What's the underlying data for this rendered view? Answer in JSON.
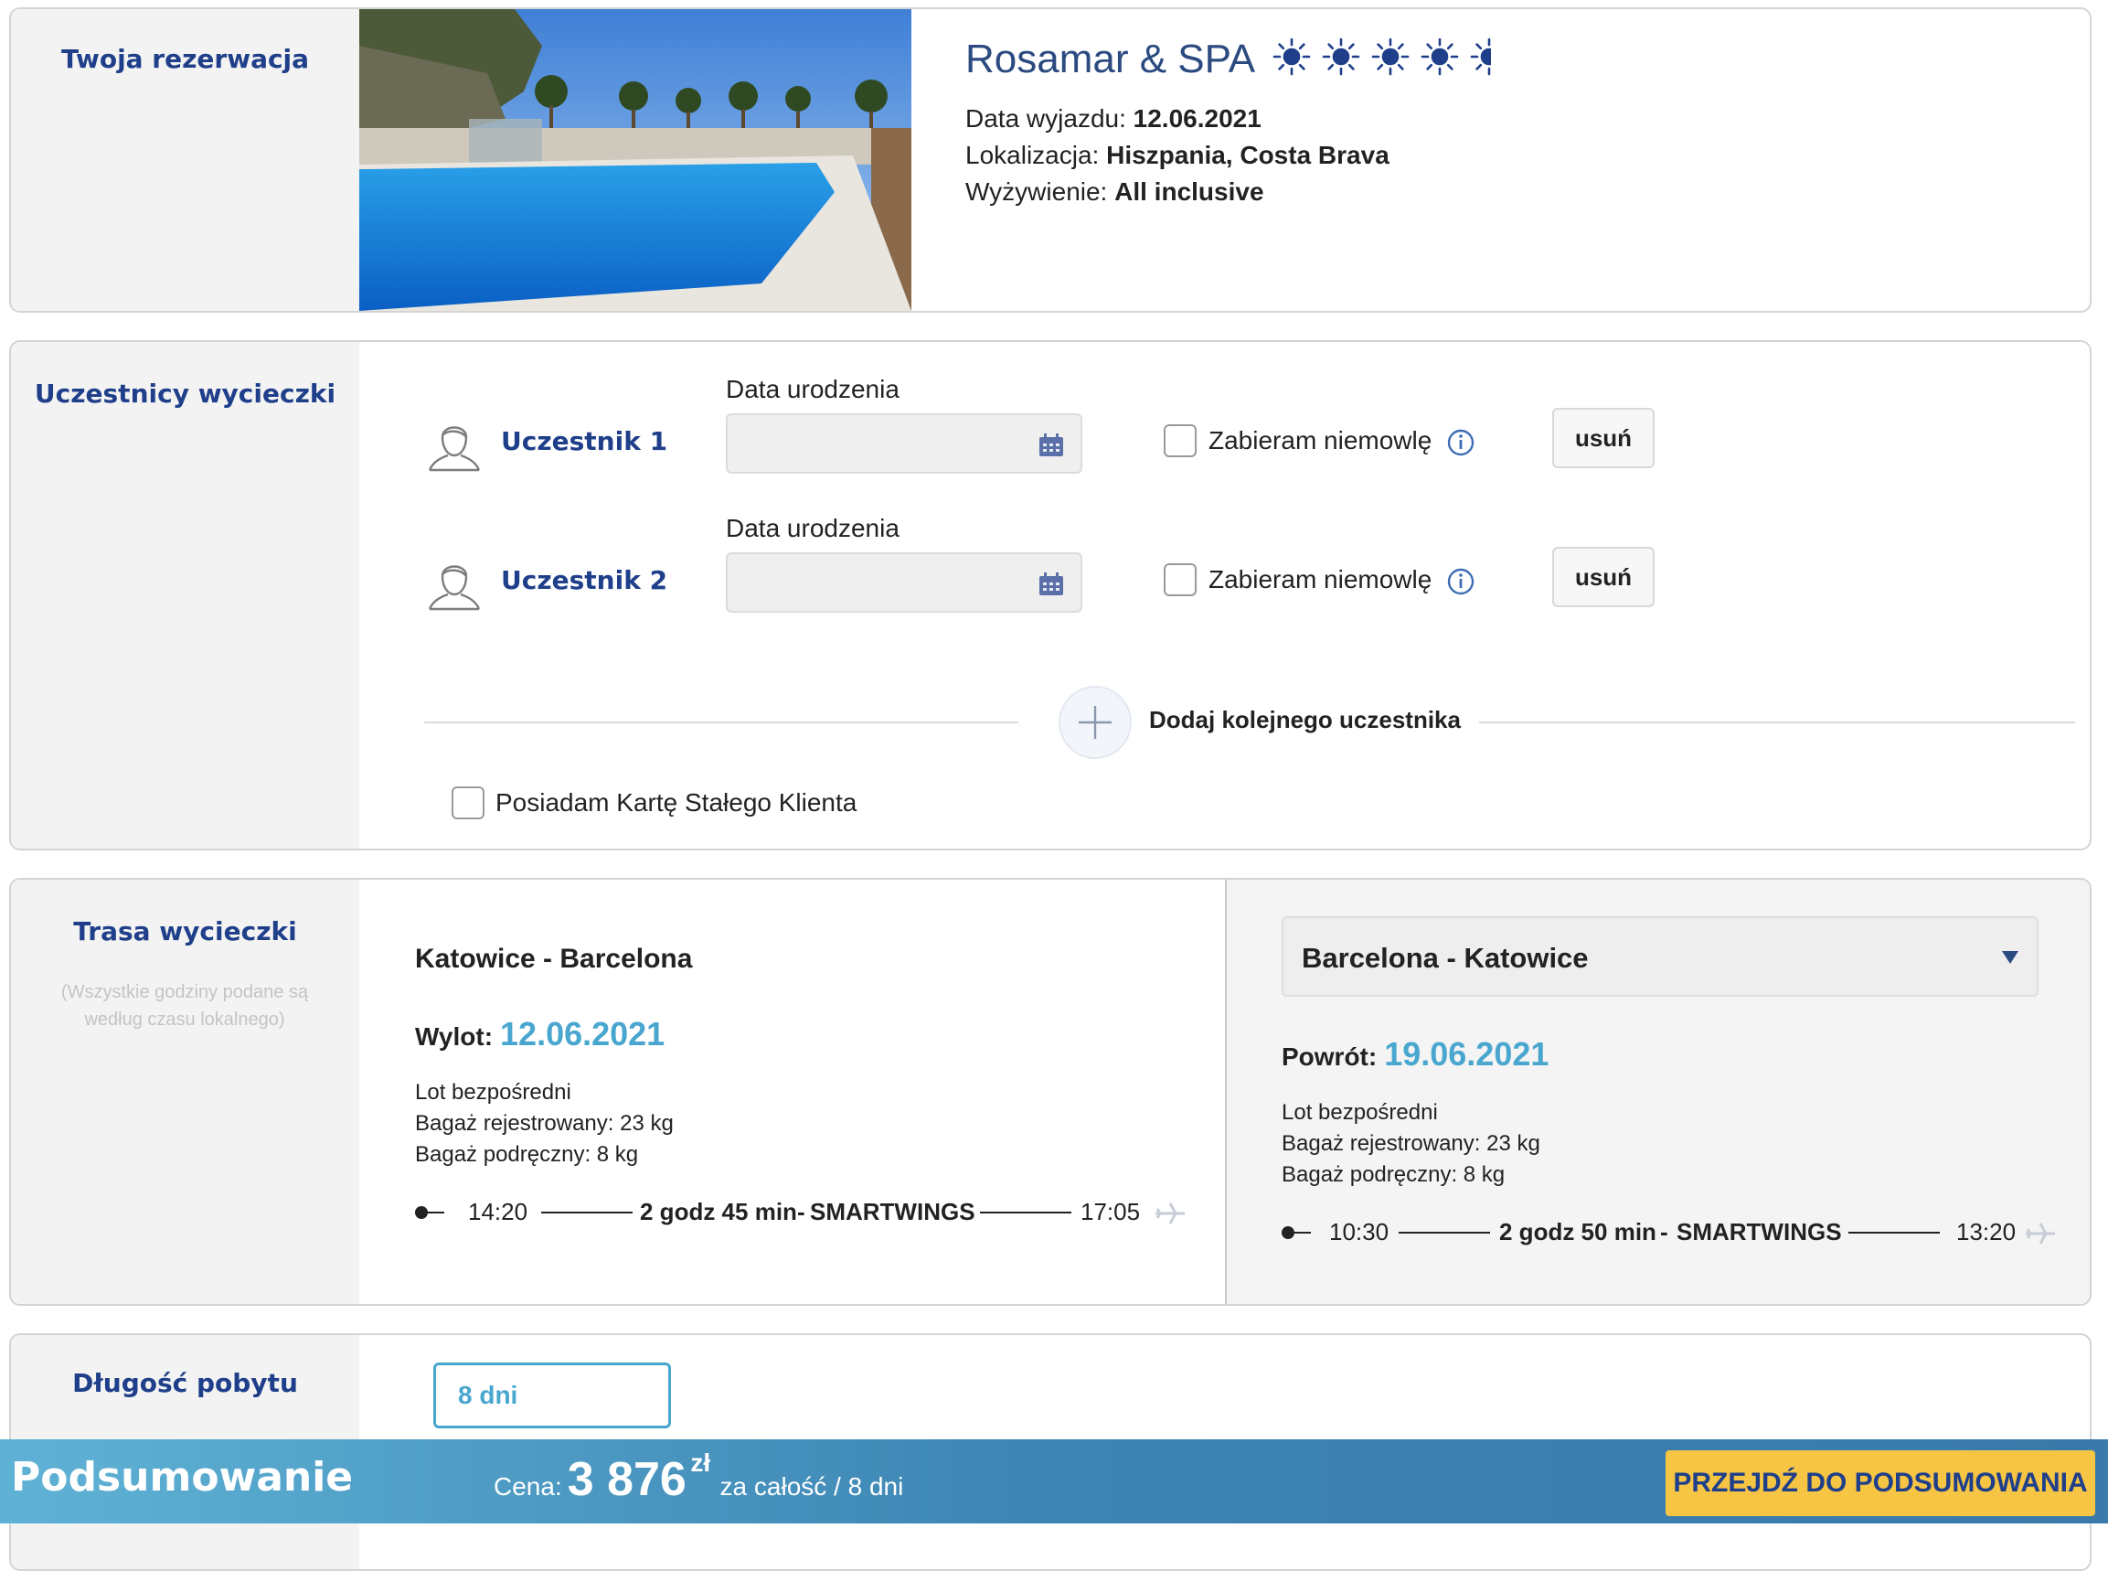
{
  "reservation": {
    "section_title": "Twoja rezerwacja",
    "hotel_name": "Rosamar & SPA",
    "rating_suns": 5,
    "departure_label": "Data wyjazdu:",
    "departure_value": "12.06.2021",
    "location_label": "Lokalizacja:",
    "location_value": "Hiszpania, Costa Brava",
    "board_label": "Wyżywienie:",
    "board_value": "All inclusive"
  },
  "participants": {
    "section_title": "Uczestnicy wycieczki",
    "dob_label": "Data urodzenia",
    "infant_label": "Zabieram niemowlę",
    "remove_label": "usuń",
    "list": [
      {
        "name": "Uczestnik 1",
        "dob_value": "",
        "infant_checked": false
      },
      {
        "name": "Uczestnik 2",
        "dob_value": "",
        "infant_checked": false
      }
    ],
    "add_label": "Dodaj kolejnego uczestnika",
    "loyalty_label": "Posiadam Kartę Stałego Klienta",
    "loyalty_checked": false
  },
  "route": {
    "section_title": "Trasa wycieczki",
    "note": "(Wszystkie godziny podane są według czasu lokalnego)",
    "outbound": {
      "title": "Katowice - Barcelona",
      "date_label": "Wylot:",
      "date_value": "12.06.2021",
      "type": "Lot bezpośredni",
      "checked_baggage": "Bagaż rejestrowany: 23 kg",
      "hand_baggage": "Bagaż podręczny: 8 kg",
      "dep_time": "14:20",
      "duration": "2 godz 45 min",
      "separator": "-",
      "carrier": "SMARTWINGS",
      "arr_time": "17:05"
    },
    "return": {
      "title": "Barcelona - Katowice",
      "date_label": "Powrót:",
      "date_value": "19.06.2021",
      "type": "Lot bezpośredni",
      "checked_baggage": "Bagaż rejestrowany: 23 kg",
      "hand_baggage": "Bagaż podręczny: 8 kg",
      "dep_time": "10:30",
      "duration": "2 godz 50 min",
      "separator": "-",
      "carrier": "SMARTWINGS",
      "arr_time": "13:20"
    }
  },
  "stay": {
    "section_title": "Długość pobytu",
    "selected": "8 dni"
  },
  "summary": {
    "title": "Podsumowanie",
    "price_label": "Cena:",
    "price_value": "3 876",
    "currency": "zł",
    "price_suffix": "za całość / 8 dni",
    "cta_label": "PRZEJDŹ DO PODSUMOWANIA"
  },
  "colors": {
    "brand_navy": "#1f3f8a",
    "accent_blue": "#49a6cf",
    "cta_yellow": "#f6c544"
  }
}
